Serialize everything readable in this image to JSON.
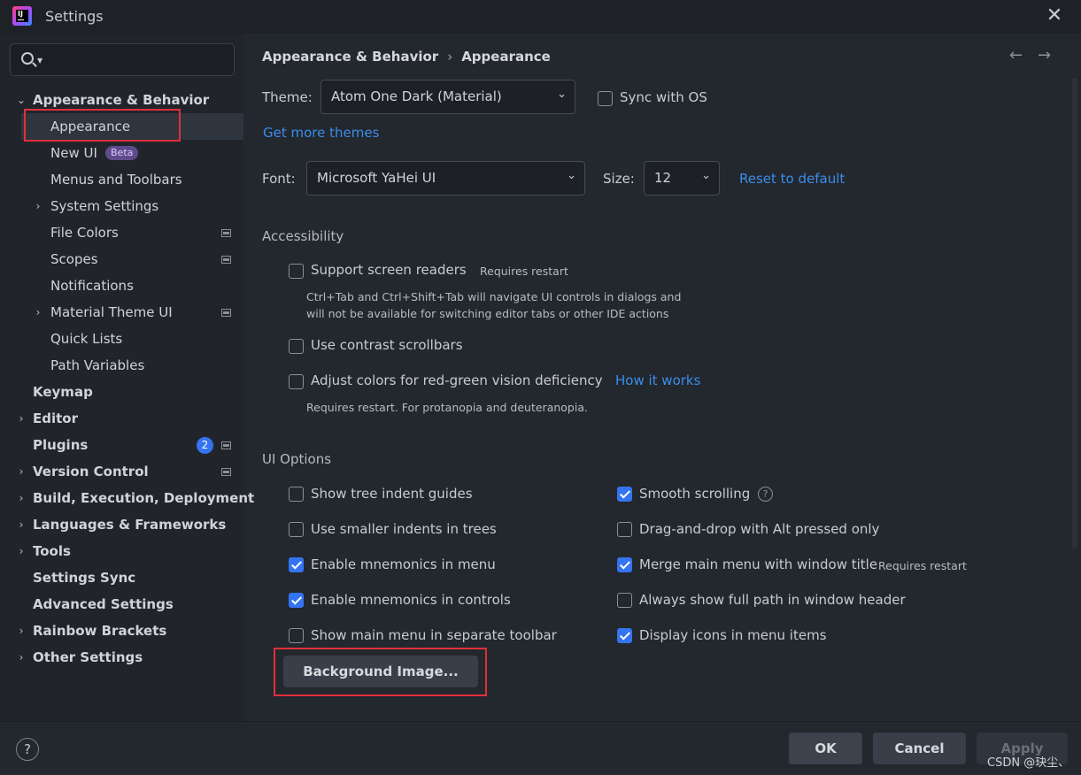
{
  "window": {
    "title": "Settings",
    "close_glyph": "✕"
  },
  "search": {
    "placeholder": ""
  },
  "sidebar": {
    "items": [
      {
        "label": "Appearance & Behavior"
      },
      {
        "label": "Appearance"
      },
      {
        "label": "New UI",
        "badge": "Beta"
      },
      {
        "label": "Menus and Toolbars"
      },
      {
        "label": "System Settings"
      },
      {
        "label": "File Colors"
      },
      {
        "label": "Scopes"
      },
      {
        "label": "Notifications"
      },
      {
        "label": "Material Theme UI"
      },
      {
        "label": "Quick Lists"
      },
      {
        "label": "Path Variables"
      },
      {
        "label": "Keymap"
      },
      {
        "label": "Editor"
      },
      {
        "label": "Plugins",
        "badge": "2"
      },
      {
        "label": "Version Control"
      },
      {
        "label": "Build, Execution, Deployment"
      },
      {
        "label": "Languages & Frameworks"
      },
      {
        "label": "Tools"
      },
      {
        "label": "Settings Sync"
      },
      {
        "label": "Advanced Settings"
      },
      {
        "label": "Rainbow Brackets"
      },
      {
        "label": "Other Settings"
      }
    ]
  },
  "breadcrumb": {
    "parent": "Appearance & Behavior",
    "current": "Appearance",
    "back": "←",
    "forward": "→"
  },
  "theme": {
    "label": "Theme:",
    "value": "Atom One Dark (Material)",
    "sync_label": "Sync with OS",
    "sync_checked": false,
    "more_link": "Get more themes"
  },
  "font": {
    "label": "Font:",
    "value": "Microsoft YaHei UI",
    "size_label": "Size:",
    "size_value": "12",
    "reset_link": "Reset to default"
  },
  "accessibility": {
    "title": "Accessibility",
    "screen_readers": {
      "label": "Support screen readers",
      "note": "Requires restart",
      "checked": false,
      "hint_1": "Ctrl+Tab and Ctrl+Shift+Tab will navigate UI controls in dialogs and",
      "hint_2": "will not be available for switching editor tabs or other IDE actions"
    },
    "contrast_scrollbars": {
      "label": "Use contrast scrollbars",
      "checked": false
    },
    "color_deficiency": {
      "label": "Adjust colors for red-green vision deficiency",
      "link": "How it works",
      "checked": false,
      "hint": "Requires restart. For protanopia and deuteranopia."
    }
  },
  "ui_options": {
    "title": "UI Options",
    "left": [
      {
        "label": "Show tree indent guides",
        "checked": false
      },
      {
        "label": "Use smaller indents in trees",
        "checked": false
      },
      {
        "label": "Enable mnemonics in menu",
        "checked": true
      },
      {
        "label": "Enable mnemonics in controls",
        "checked": true
      },
      {
        "label": "Show main menu in separate toolbar",
        "checked": false
      }
    ],
    "right": [
      {
        "label": "Smooth scrolling",
        "checked": true
      },
      {
        "label": "Drag-and-drop with Alt pressed only",
        "checked": false
      },
      {
        "label": "Merge main menu with window title",
        "note": "Requires restart",
        "checked": true
      },
      {
        "label": "Always show full path in window header",
        "checked": false
      },
      {
        "label": "Display icons in menu items",
        "checked": true
      }
    ],
    "background_button": "Background Image..."
  },
  "footer": {
    "help": "?",
    "ok": "OK",
    "cancel": "Cancel",
    "apply": "Apply",
    "watermark": "CSDN @玦尘、"
  },
  "colors": {
    "accent": "#3574f0",
    "link": "#3b8eea",
    "highlight_box": "#e0303a",
    "background": "#23272e"
  }
}
